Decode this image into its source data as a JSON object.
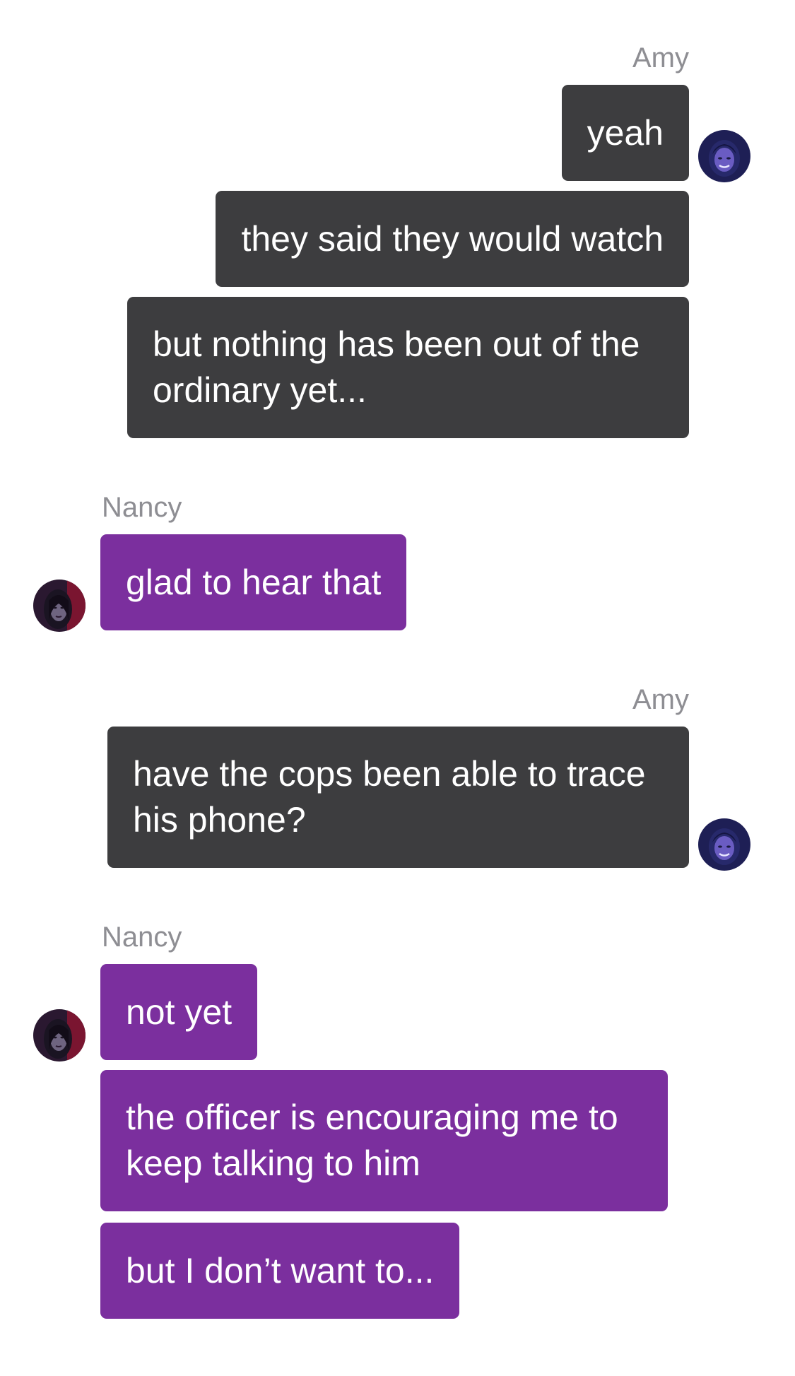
{
  "chat": {
    "groups": [
      {
        "sender": "Amy",
        "messages": [
          "yeah",
          "they said they would watch",
          "but nothing has been out of the ordinary yet..."
        ]
      },
      {
        "sender": "Nancy",
        "messages": [
          "glad to hear that"
        ]
      },
      {
        "sender": "Amy",
        "messages": [
          "have the cops been able to trace his phone?"
        ]
      },
      {
        "sender": "Nancy",
        "messages": [
          "not yet",
          "the officer is encouraging me to keep talking to him",
          "but I don’t want to..."
        ]
      }
    ]
  },
  "colors": {
    "amy_bubble": "#3d3d3f",
    "nancy_bubble": "#7b2f9e",
    "sender_name": "#8e8e93"
  },
  "icons": {
    "amy_avatar": "amy-avatar-icon",
    "nancy_avatar": "nancy-avatar-icon"
  }
}
